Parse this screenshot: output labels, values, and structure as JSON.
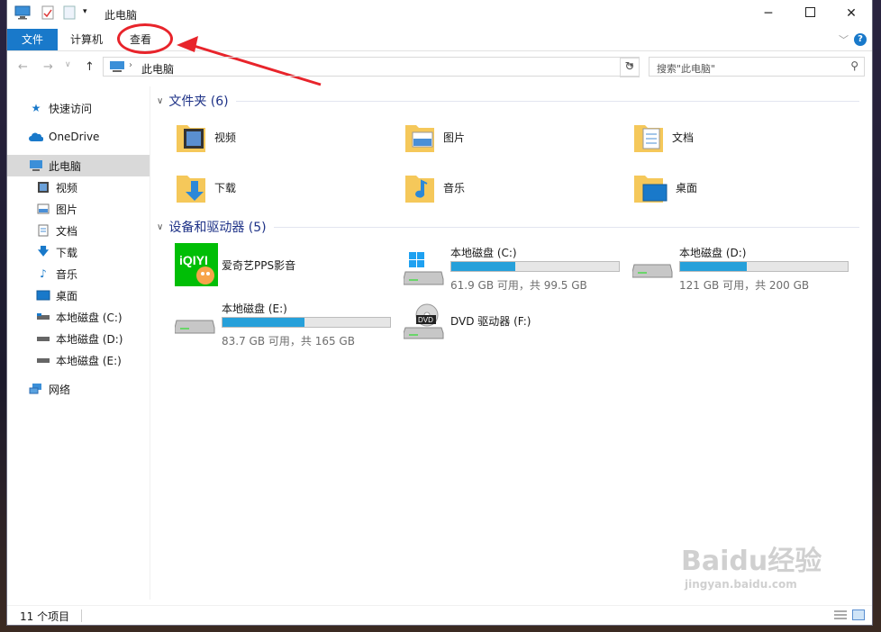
{
  "window": {
    "title": "此电脑"
  },
  "ribbon": {
    "tabs": [
      "文件",
      "计算机",
      "查看"
    ]
  },
  "address": {
    "path": "此电脑",
    "search_placeholder": "搜索\"此电脑\""
  },
  "nav": {
    "items": [
      {
        "label": "快速访问",
        "icon": "star-icon"
      },
      {
        "label": "OneDrive",
        "icon": "cloud-icon"
      },
      {
        "label": "此电脑",
        "icon": "computer-icon",
        "selected": true
      },
      {
        "label": "视频",
        "icon": "video-icon"
      },
      {
        "label": "图片",
        "icon": "picture-icon"
      },
      {
        "label": "文档",
        "icon": "document-icon"
      },
      {
        "label": "下载",
        "icon": "download-icon"
      },
      {
        "label": "音乐",
        "icon": "music-icon"
      },
      {
        "label": "桌面",
        "icon": "desktop-icon"
      },
      {
        "label": "本地磁盘 (C:)",
        "icon": "drive-icon"
      },
      {
        "label": "本地磁盘 (D:)",
        "icon": "drive-icon"
      },
      {
        "label": "本地磁盘 (E:)",
        "icon": "drive-icon"
      },
      {
        "label": "网络",
        "icon": "network-icon"
      }
    ]
  },
  "folders": {
    "header": "文件夹 (6)",
    "items": [
      {
        "label": "视频",
        "icon": "video-folder-icon"
      },
      {
        "label": "图片",
        "icon": "picture-folder-icon"
      },
      {
        "label": "文档",
        "icon": "document-folder-icon"
      },
      {
        "label": "下载",
        "icon": "download-folder-icon"
      },
      {
        "label": "音乐",
        "icon": "music-folder-icon"
      },
      {
        "label": "桌面",
        "icon": "desktop-folder-icon"
      }
    ]
  },
  "devices": {
    "header": "设备和驱动器 (5)",
    "items": [
      {
        "label": "爱奇艺PPS影音",
        "icon": "iqiyi-icon"
      },
      {
        "label": "本地磁盘 (C:)",
        "free": "61.9 GB 可用，共 99.5 GB",
        "used_fraction": 0.38,
        "icon": "windows-drive-icon"
      },
      {
        "label": "本地磁盘 (D:)",
        "free": "121 GB 可用，共 200 GB",
        "used_fraction": 0.4,
        "icon": "drive-icon"
      },
      {
        "label": "本地磁盘 (E:)",
        "free": "83.7 GB 可用，共 165 GB",
        "used_fraction": 0.49,
        "icon": "drive-icon"
      },
      {
        "label": "DVD 驱动器 (F:)",
        "icon": "dvd-icon"
      }
    ]
  },
  "status": {
    "count": "11 个项目"
  },
  "watermark": {
    "text": "Baidu经验",
    "sub": "jingyan.baidu.com"
  },
  "colors": {
    "accent": "#1979ca",
    "bar": "#26a0da",
    "annotation": "#e8242b",
    "group_header": "#1e3287"
  }
}
